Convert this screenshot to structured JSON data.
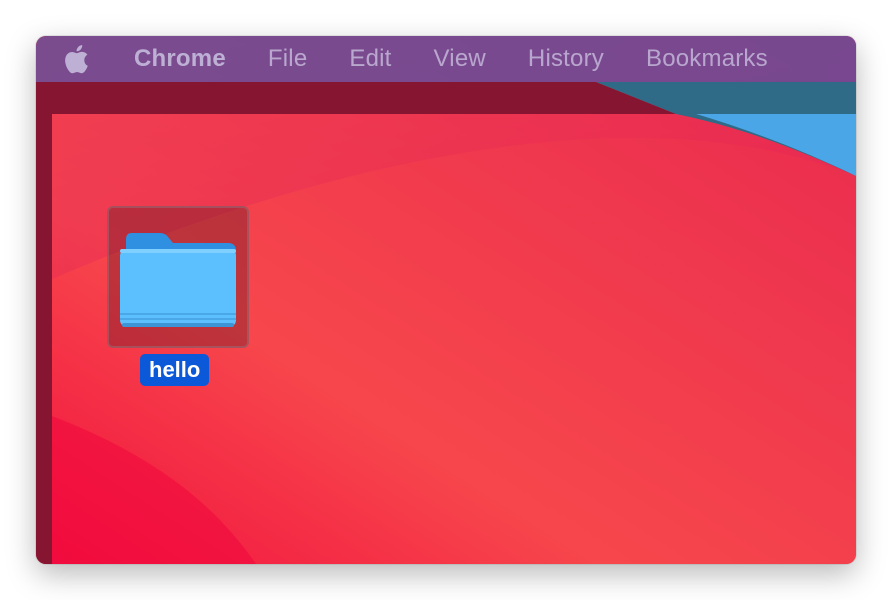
{
  "menubar": {
    "apple_icon": "apple-logo-icon",
    "items": [
      "Chrome",
      "File",
      "Edit",
      "View",
      "History",
      "Bookmarks"
    ]
  },
  "desktop": {
    "items": [
      {
        "label": "hello",
        "icon": "folder-icon",
        "selected": true
      }
    ]
  },
  "colors": {
    "menubar_bg": "#5850a0",
    "wallpaper_red": "#f04a4d",
    "wallpaper_dark": "#8a1532",
    "wallpaper_blue": "#4aa6e6",
    "selection_label": "#0b58d8",
    "folder_blue": "#5cc0ff"
  }
}
